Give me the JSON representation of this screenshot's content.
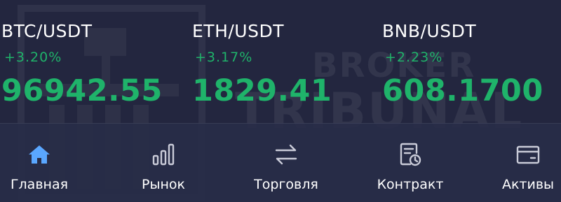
{
  "watermark": {
    "line1": "BROKER",
    "line2": "TRIBUNAL"
  },
  "tickers": [
    {
      "pair": "BTC/USDT",
      "change": "+3.20%",
      "price": "96942.55"
    },
    {
      "pair": "ETH/USDT",
      "change": "+3.17%",
      "price": "1829.41"
    },
    {
      "pair": "BNB/USDT",
      "change": "+2.23%",
      "price": "608.1700"
    }
  ],
  "nav": {
    "items": [
      {
        "label": "Главная",
        "icon": "home-icon",
        "active": true
      },
      {
        "label": "Рынок",
        "icon": "bar-chart-icon"
      },
      {
        "label": "Торговля",
        "icon": "swap-arrows-icon"
      },
      {
        "label": "Контракт",
        "icon": "contract-clock-icon"
      },
      {
        "label": "Активы",
        "icon": "wallet-card-icon"
      }
    ]
  },
  "colors": {
    "background": "#23263f",
    "positive": "#1fb36a",
    "active_icon": "#5aa7ff",
    "icon": "#c9cbd8"
  }
}
